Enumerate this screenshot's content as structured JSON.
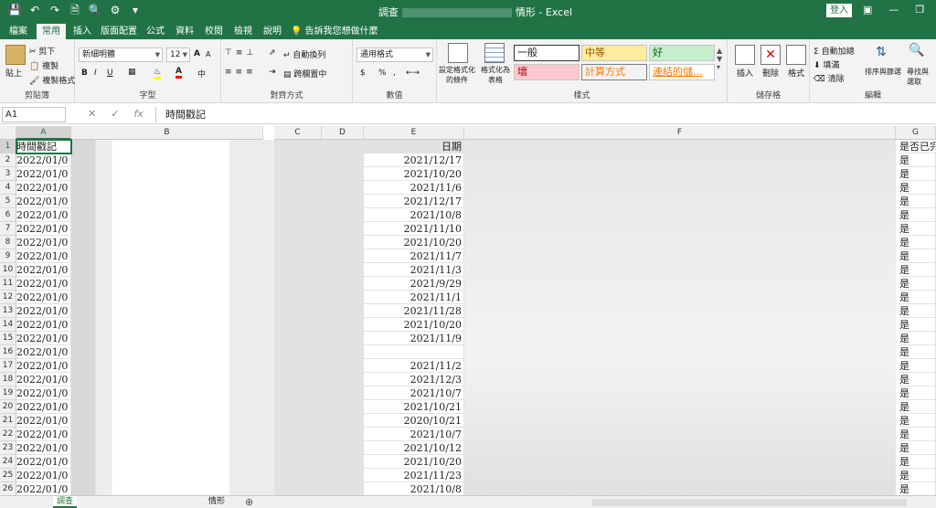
{
  "titlebar": {
    "title_prefix": "調查",
    "title_suffix": "情形 - Excel",
    "signin": "登入"
  },
  "tabs": [
    "檔案",
    "常用",
    "插入",
    "版面配置",
    "公式",
    "資料",
    "校閱",
    "檢視",
    "說明"
  ],
  "active_tab": "常用",
  "tell_me": "告訴我您想做什麼",
  "ribbon": {
    "clipboard": {
      "paste": "貼上",
      "cut": "剪下",
      "copy": "複製",
      "format_painter": "複製格式",
      "label": "剪貼簿"
    },
    "font": {
      "name": "新細明體",
      "size": "12",
      "bold": "B",
      "italic": "I",
      "underline": "U",
      "grow": "A",
      "shrink": "A",
      "label": "字型"
    },
    "alignment": {
      "wrap": "自動換列",
      "merge": "跨欄置中",
      "label": "對齊方式"
    },
    "number": {
      "format": "通用格式",
      "currency": "$",
      "percent": "%",
      "comma": ",",
      "label": "數值"
    },
    "styles": {
      "conditional": "設定格式化的條件",
      "as_table": "格式化為表格",
      "normal": "一般",
      "neutral": "中等",
      "good": "好",
      "bad": "壞",
      "calc": "計算方式",
      "link": "連結的儲...",
      "label": "樣式"
    },
    "cells": {
      "insert": "插入",
      "delete": "刪除",
      "format": "格式",
      "label": "儲存格"
    },
    "editing": {
      "autosum": "自動加總",
      "fill": "填滿",
      "clear": "清除",
      "sort": "排序與篩選",
      "find": "尋找與選取",
      "label": "編輯"
    }
  },
  "formula_bar": {
    "name_box": "A1",
    "fx": "fx",
    "content": "時間戳記"
  },
  "columns": [
    "A",
    "B",
    "C",
    "D",
    "E",
    "F",
    "G"
  ],
  "header_row": {
    "A": "時間戳記",
    "E": "日期",
    "G": "是否已完"
  },
  "rows": [
    {
      "n": "1"
    },
    {
      "n": "2",
      "A": "2022/01/0",
      "E": "2021/12/17",
      "G": "是"
    },
    {
      "n": "3",
      "A": "2022/01/0",
      "E": "2021/10/20",
      "G": "是"
    },
    {
      "n": "4",
      "A": "2022/01/0",
      "E": "2021/11/6",
      "G": "是"
    },
    {
      "n": "5",
      "A": "2022/01/0",
      "E": "2021/12/17",
      "G": "是"
    },
    {
      "n": "6",
      "A": "2022/01/0",
      "E": "2021/10/8",
      "G": "是"
    },
    {
      "n": "7",
      "A": "2022/01/0",
      "E": "2021/11/10",
      "G": "是"
    },
    {
      "n": "8",
      "A": "2022/01/0",
      "E": "2021/10/20",
      "G": "是"
    },
    {
      "n": "9",
      "A": "2022/01/0",
      "E": "2021/11/7",
      "G": "是"
    },
    {
      "n": "10",
      "A": "2022/01/0",
      "E": "2021/11/3",
      "G": "是"
    },
    {
      "n": "11",
      "A": "2022/01/0",
      "E": "2021/9/29",
      "G": "是"
    },
    {
      "n": "12",
      "A": "2022/01/0",
      "E": "2021/11/1",
      "G": "是"
    },
    {
      "n": "13",
      "A": "2022/01/0",
      "E": "2021/11/28",
      "G": "是"
    },
    {
      "n": "14",
      "A": "2022/01/0",
      "E": "2021/10/20",
      "G": "是"
    },
    {
      "n": "15",
      "A": "2022/01/0",
      "E": "2021/11/9",
      "G": "是"
    },
    {
      "n": "16",
      "A": "2022/01/0",
      "E": "",
      "G": "是"
    },
    {
      "n": "17",
      "A": "2022/01/0",
      "E": "2021/11/2",
      "G": "是"
    },
    {
      "n": "18",
      "A": "2022/01/0",
      "E": "2021/12/3",
      "G": "是"
    },
    {
      "n": "19",
      "A": "2022/01/0",
      "E": "2021/10/7",
      "G": "是"
    },
    {
      "n": "20",
      "A": "2022/01/0",
      "E": "2021/10/21",
      "G": "是"
    },
    {
      "n": "21",
      "A": "2022/01/0",
      "E": "2020/10/21",
      "G": "是"
    },
    {
      "n": "22",
      "A": "2022/01/0",
      "E": "2021/10/7",
      "G": "是"
    },
    {
      "n": "23",
      "A": "2022/01/0",
      "E": "2021/10/12",
      "G": "是"
    },
    {
      "n": "24",
      "A": "2022/01/0",
      "E": "2021/10/20",
      "G": "是"
    },
    {
      "n": "25",
      "A": "2022/01/0",
      "E": "2021/11/23",
      "G": "是"
    },
    {
      "n": "26",
      "A": "2022/01/0",
      "E": "2021/10/8",
      "G": "是"
    }
  ],
  "sheets": [
    "調查",
    "情形"
  ],
  "active_sheet": "調查",
  "colors": {
    "excel_green": "#217346"
  }
}
